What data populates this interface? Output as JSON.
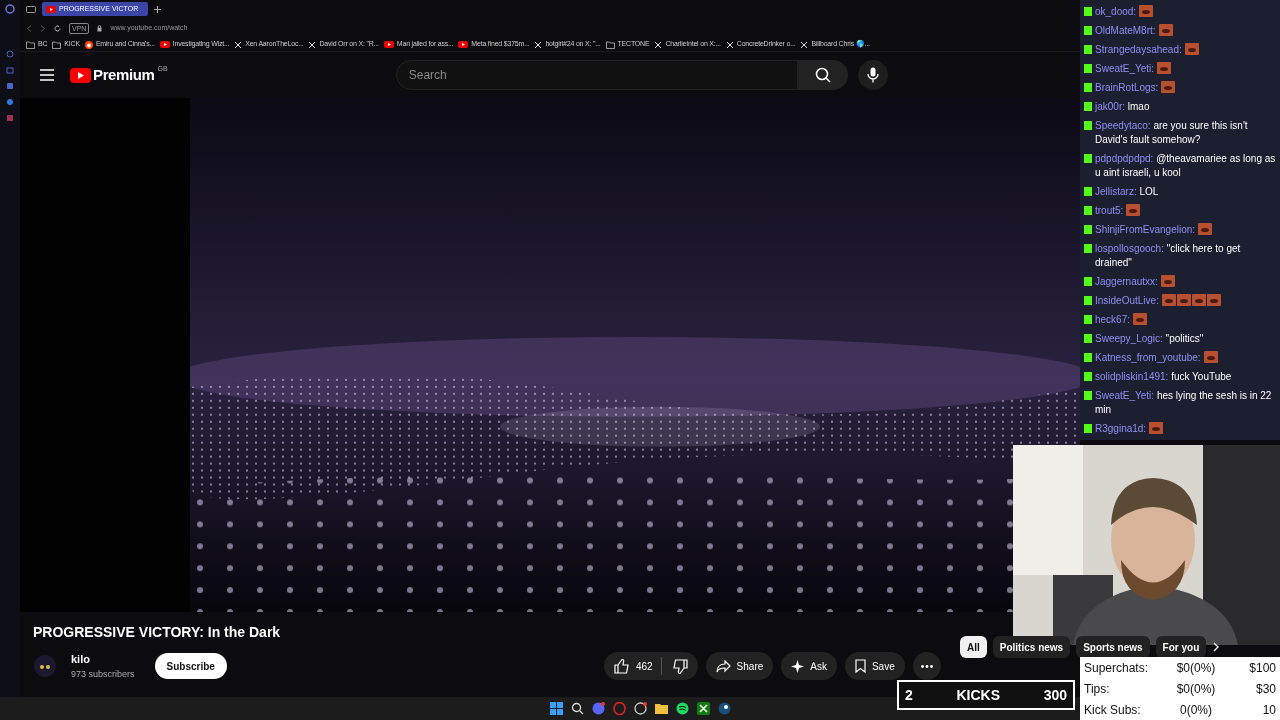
{
  "browser": {
    "tab": {
      "title": "PROGRESSIVE VICTOR",
      "selected": true
    },
    "url": "www.youtube.com/watch",
    "vpn": "VPN",
    "bookmarks": [
      {
        "kind": "folder",
        "label": "BC"
      },
      {
        "kind": "folder",
        "label": "KICK"
      },
      {
        "kind": "reddit",
        "label": "Emiru and Cinna's..."
      },
      {
        "kind": "youtube",
        "label": "Investigating Wizt..."
      },
      {
        "kind": "x",
        "label": "Xen AaronTheLoc..."
      },
      {
        "kind": "x",
        "label": "David Orr on X: \"R..."
      },
      {
        "kind": "youtube",
        "label": "Man jailed for ass..."
      },
      {
        "kind": "youtube",
        "label": "Meta fined $375m..."
      },
      {
        "kind": "x",
        "label": "hotgirl#24 on X: \"..."
      },
      {
        "kind": "folder",
        "label": "TECTONE"
      },
      {
        "kind": "x",
        "label": "CharlieIntel on X:..."
      },
      {
        "kind": "x",
        "label": "ConcreteDrinker o..."
      },
      {
        "kind": "x",
        "label": "Billboard Chris 🌎..."
      }
    ]
  },
  "youtube": {
    "logo": "Premium",
    "region": "GB",
    "search": {
      "placeholder": "Search"
    },
    "video": {
      "title": "PROGRESSIVE VICTORY: In the Dark"
    },
    "channel": {
      "name": "kilo",
      "subscribers": "973 subscribers"
    },
    "subscribe": "Subscribe",
    "likes": "462",
    "actions": [
      "Share",
      "Ask",
      "Save"
    ],
    "chips": [
      {
        "label": "All",
        "selected": true
      },
      {
        "label": "Politics news",
        "selected": false
      },
      {
        "label": "Sports news",
        "selected": false
      },
      {
        "label": "For you",
        "selected": false
      }
    ]
  },
  "chat": [
    {
      "user": "ok_dood:",
      "kind": "emote"
    },
    {
      "user": "OldMateM8rt:",
      "kind": "emote"
    },
    {
      "user": "Strangedaysahead:",
      "kind": "emote"
    },
    {
      "user": "SweatE_Yeti:",
      "kind": "emote"
    },
    {
      "user": "BrainRotLogs:",
      "kind": "emote"
    },
    {
      "user": "jak00r:",
      "kind": "text",
      "text": "lmao"
    },
    {
      "user": "Speedytaco:",
      "kind": "text",
      "text": "are you sure this isn't David's fault somehow?"
    },
    {
      "user": "pdpdpdpdpd:",
      "kind": "text",
      "text": "@theavamariee as long as u aint israeli, u kool"
    },
    {
      "user": "Jellistarz:",
      "kind": "text",
      "text": "LOL"
    },
    {
      "user": "trout5:",
      "kind": "emote"
    },
    {
      "user": "ShinjiFromEvangelion:",
      "kind": "emote"
    },
    {
      "user": "lospollosgooch:",
      "kind": "text",
      "text": "\"click here to get drained\""
    },
    {
      "user": "Jaggernautxx:",
      "kind": "emote"
    },
    {
      "user": "InsideOutLive:",
      "kind": "emote_row"
    },
    {
      "user": "heck67:",
      "kind": "emote"
    },
    {
      "user": "Sweepy_Logic:",
      "kind": "text",
      "text": "\"politics\""
    },
    {
      "user": "Katness_from_youtube:",
      "kind": "emote"
    },
    {
      "user": "solidpliskin1491:",
      "kind": "text",
      "text": "fuck YouTube"
    },
    {
      "user": "SweatE_Yeti:",
      "kind": "text",
      "text": "hes lying the sesh is in 22 min"
    },
    {
      "user": "R3ggina1d:",
      "kind": "emote"
    }
  ],
  "goals": {
    "kicks": {
      "count": "2",
      "label": "KICKS",
      "target": "300"
    },
    "rows": [
      {
        "label": "Superchats:",
        "value": "$0(0%)",
        "target": "$100"
      },
      {
        "label": "Tips:",
        "value": "$0(0%)",
        "target": "$30"
      },
      {
        "label": "Kick Subs:",
        "value": "0(0%)",
        "target": "10"
      }
    ]
  }
}
